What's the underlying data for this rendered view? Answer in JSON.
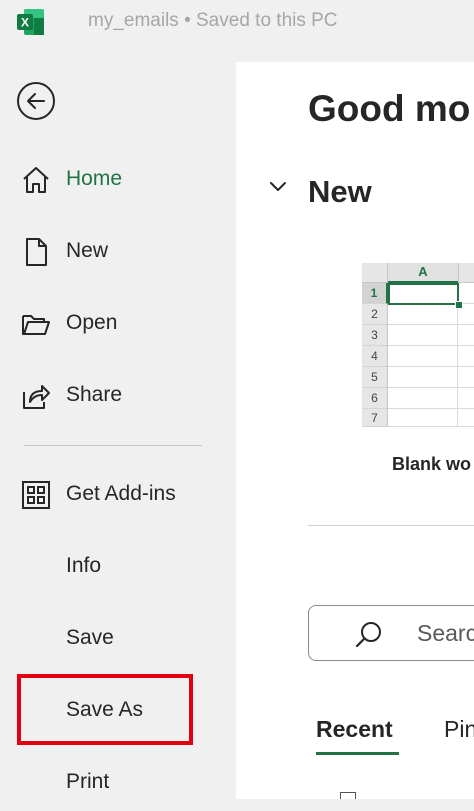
{
  "titlebar": {
    "app_icon": "excel-logo-icon",
    "app_letter": "X",
    "title": "my_emails • Saved to this PC"
  },
  "colors": {
    "excel_green": "#217346",
    "highlight_red": "#e3000f",
    "sidebar_bg": "#f0f0f0"
  },
  "sidebar": {
    "back_icon": "back-arrow-icon",
    "items": [
      {
        "label": "Home",
        "icon": "home-icon",
        "active": true
      },
      {
        "label": "New",
        "icon": "new-document-icon"
      },
      {
        "label": "Open",
        "icon": "open-folder-icon"
      },
      {
        "label": "Share",
        "icon": "share-icon"
      },
      {
        "label": "Get Add-ins",
        "icon": "add-ins-grid-icon"
      },
      {
        "label": "Info"
      },
      {
        "label": "Save"
      },
      {
        "label": "Save As",
        "highlighted": true
      },
      {
        "label": "Print"
      }
    ]
  },
  "main": {
    "greeting": "Good mo",
    "new_section": {
      "heading": "New",
      "template_label": "Blank wo",
      "thumbnail": {
        "column_header": "A",
        "row_numbers": [
          "1",
          "2",
          "3",
          "4",
          "5",
          "6",
          "7"
        ]
      }
    },
    "search": {
      "placeholder": "Searc"
    },
    "tabs": [
      {
        "label": "Recent",
        "selected": true
      },
      {
        "label": "Pin"
      }
    ]
  }
}
